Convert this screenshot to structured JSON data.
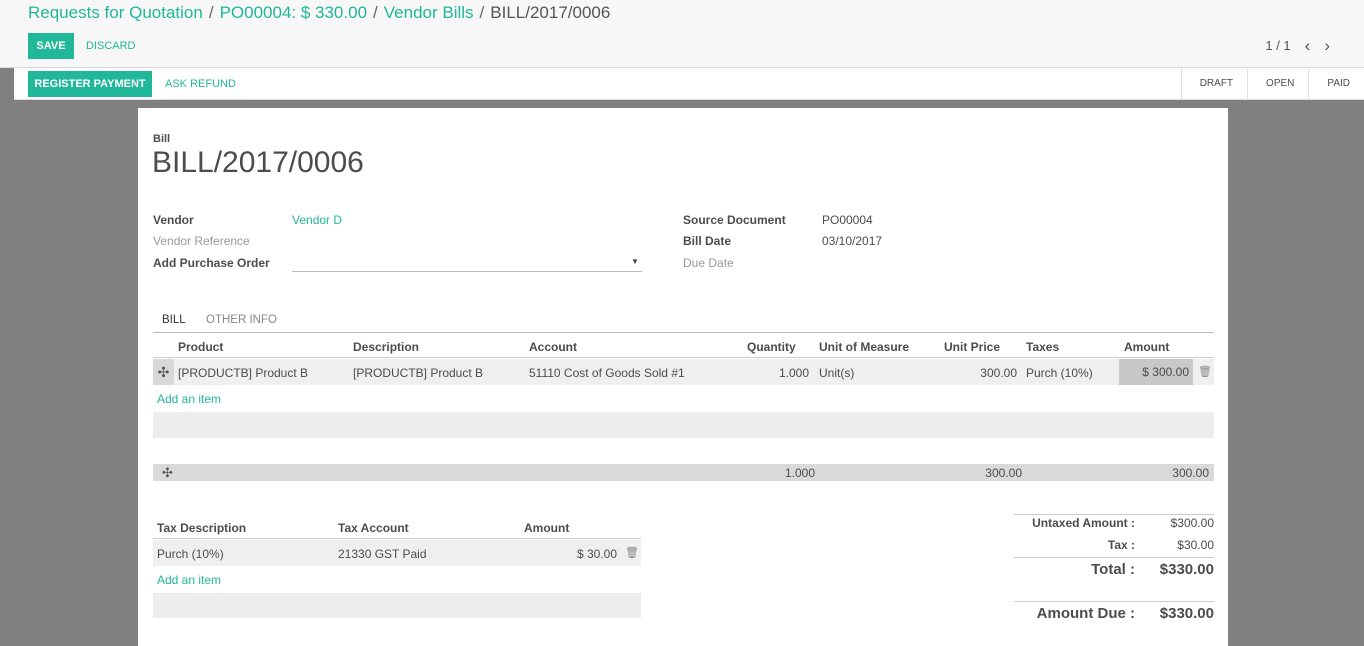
{
  "breadcrumb": {
    "items": [
      "Requests for Quotation",
      "PO00004: $ 330.00",
      "Vendor Bills"
    ],
    "current": "BILL/2017/0006",
    "separator": "/"
  },
  "buttons": {
    "save": "SAVE",
    "discard": "DISCARD",
    "register_payment": "REGISTER PAYMENT",
    "ask_refund": "ASK REFUND"
  },
  "pager": {
    "value": "1 / 1",
    "prev": "‹",
    "next": "›"
  },
  "status": {
    "stages": [
      "DRAFT",
      "OPEN",
      "PAID"
    ],
    "current": "DRAFT"
  },
  "bill": {
    "type_label": "Bill",
    "number": "BILL/2017/0006",
    "fields_left": [
      {
        "label": "Vendor",
        "value": "Vendor D"
      },
      {
        "label": "Vendor Reference",
        "value": ""
      },
      {
        "label": "Add Purchase Order",
        "value": ""
      }
    ],
    "fields_right": [
      {
        "label": "Source Document",
        "value": "PO00004"
      },
      {
        "label": "Bill Date",
        "value": "03/10/2017"
      },
      {
        "label": "Due Date",
        "value": ""
      }
    ]
  },
  "tabs": [
    "BILL",
    "OTHER INFO"
  ],
  "lines": {
    "columns": [
      "Product",
      "Description",
      "Account",
      "Quantity",
      "Unit of Measure",
      "Unit Price",
      "Taxes",
      "Amount"
    ],
    "rows": [
      {
        "product": "[PRODUCTB] Product B",
        "description": "[PRODUCTB] Product B",
        "account": "51110 Cost of Goods Sold #1",
        "quantity": "1.000",
        "uom": "Unit(s)",
        "unit_price": "300.00",
        "taxes": "Purch (10%)",
        "amount": "$ 300.00"
      }
    ],
    "add_item": "Add an item",
    "totals": {
      "quantity": "1.000",
      "unit_price": "300.00",
      "amount": "300.00"
    }
  },
  "tax_lines": {
    "columns": [
      "Tax Description",
      "Tax Account",
      "Amount"
    ],
    "rows": [
      {
        "description": "Purch (10%)",
        "account": "21330 GST Paid",
        "amount": "$ 30.00"
      }
    ],
    "add_item": "Add an item"
  },
  "summary": {
    "untaxed_label": "Untaxed Amount :",
    "untaxed": "$300.00",
    "tax_label": "Tax :",
    "tax": "$30.00",
    "total_label": "Total :",
    "total": "$330.00",
    "due_label": "Amount Due :",
    "due": "$330.00"
  },
  "icons": {
    "drag": "drag-handle-icon",
    "trash": "trash-icon",
    "dropdown": "caret-down-icon"
  },
  "colors": {
    "accent": "#21b799",
    "background": "#808080"
  }
}
